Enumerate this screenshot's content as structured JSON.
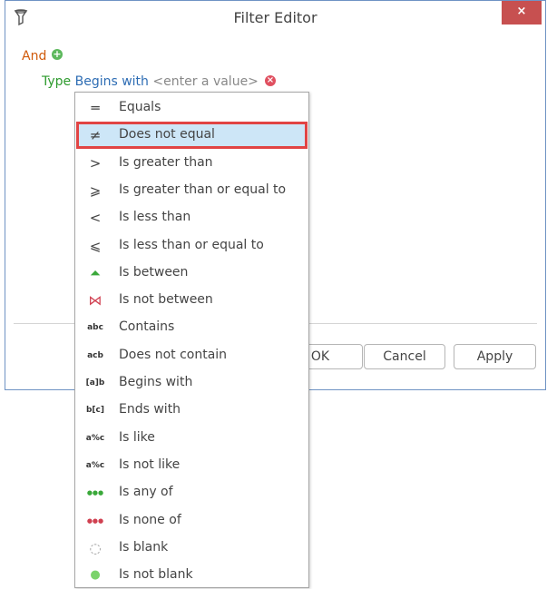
{
  "window": {
    "title": "Filter Editor",
    "close_label": "×",
    "accent": "#6f93c4",
    "close_color": "#c75050"
  },
  "filter": {
    "group_operator": "And",
    "add_label": "+",
    "condition": {
      "field": "Type",
      "operator": "Begins with",
      "value_placeholder": "<enter a value>",
      "remove_label": "×"
    }
  },
  "footer": {
    "ok_label": "OK",
    "cancel_label": "Cancel",
    "apply_label": "Apply"
  },
  "dropdown": {
    "selected_index": 1,
    "items": [
      {
        "label": "Equals",
        "icon": "equals-icon",
        "glyph": "═"
      },
      {
        "label": "Does not equal",
        "icon": "not-equal-icon",
        "glyph": "≠"
      },
      {
        "label": "Is greater than",
        "icon": "greater-than-icon",
        "glyph": ">"
      },
      {
        "label": "Is greater than or equal to",
        "icon": "greater-equal-icon",
        "glyph": "⩾"
      },
      {
        "label": "Is less than",
        "icon": "less-than-icon",
        "glyph": "<"
      },
      {
        "label": "Is less than or equal to",
        "icon": "less-equal-icon",
        "glyph": "⩽"
      },
      {
        "label": "Is between",
        "icon": "between-icon",
        "glyph": "⏶"
      },
      {
        "label": "Is not between",
        "icon": "not-between-icon",
        "glyph": "⋈"
      },
      {
        "label": "Contains",
        "icon": "contains-icon",
        "glyph": "abc"
      },
      {
        "label": "Does not contain",
        "icon": "not-contains-icon",
        "glyph": "acb"
      },
      {
        "label": "Begins with",
        "icon": "begins-with-icon",
        "glyph": "[a]b"
      },
      {
        "label": "Ends with",
        "icon": "ends-with-icon",
        "glyph": "b[c]"
      },
      {
        "label": "Is like",
        "icon": "like-icon",
        "glyph": "a%c"
      },
      {
        "label": "Is not like",
        "icon": "not-like-icon",
        "glyph": "a%c"
      },
      {
        "label": "Is any of",
        "icon": "any-of-icon",
        "glyph": "●●●"
      },
      {
        "label": "Is none of",
        "icon": "none-of-icon",
        "glyph": "●●●"
      },
      {
        "label": "Is blank",
        "icon": "blank-icon",
        "glyph": "◌"
      },
      {
        "label": "Is not blank",
        "icon": "not-blank-icon",
        "glyph": "●"
      }
    ],
    "colors": {
      "between": "#3aa83a",
      "not_between": "#d04050",
      "any_of": "#3aa83a",
      "none_of": "#d04050",
      "not_blank": "#7bd36b"
    }
  }
}
